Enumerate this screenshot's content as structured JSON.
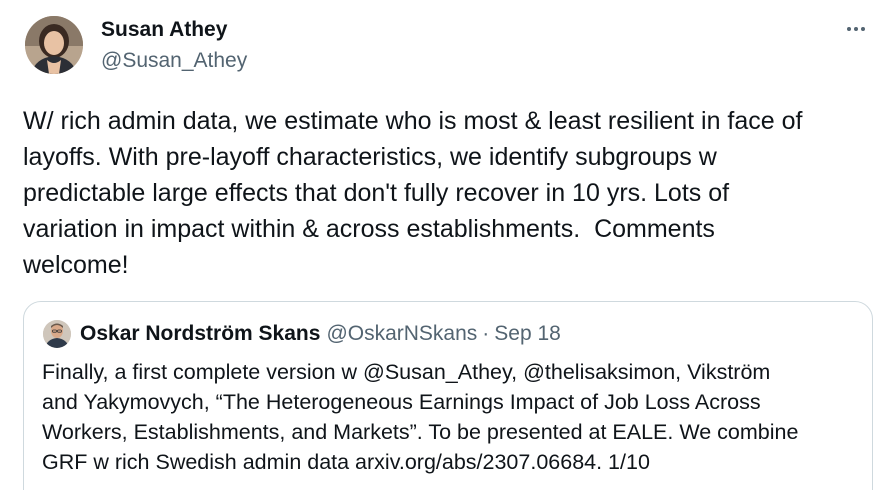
{
  "author": {
    "name": "Susan Athey",
    "handle": "@Susan_Athey",
    "avatar_icon": "person-photo-icon"
  },
  "more_icon": "more-horizontal-icon",
  "tweet": {
    "lines": [
      "W/ rich admin data, we estimate who is most & least resilient in face of",
      "layoffs. With pre-layoff characteristics, we identify subgroups w",
      "predictable large effects that don't fully recover in 10 yrs. Lots of",
      "variation in impact within & across establishments.  Comments",
      "welcome!"
    ]
  },
  "quoted": {
    "name": "Oskar Nordström Skans",
    "handle": "@OskarNSkans",
    "separator": "·",
    "date": "Sep 18",
    "avatar_icon": "person-photo-icon",
    "lines": [
      "Finally, a first complete version w @Susan_Athey, @thelisaksimon, Vikström",
      "and Yakymovych, “The Heterogeneous Earnings Impact of Job Loss Across",
      "Workers, Establishments, and Markets”. To be presented at EALE. We combine",
      "GRF w rich Swedish admin data arxiv.org/abs/2307.06684. 1/10"
    ]
  },
  "colors": {
    "text": "#0f1419",
    "secondary": "#536471",
    "border": "#cfd9de"
  }
}
